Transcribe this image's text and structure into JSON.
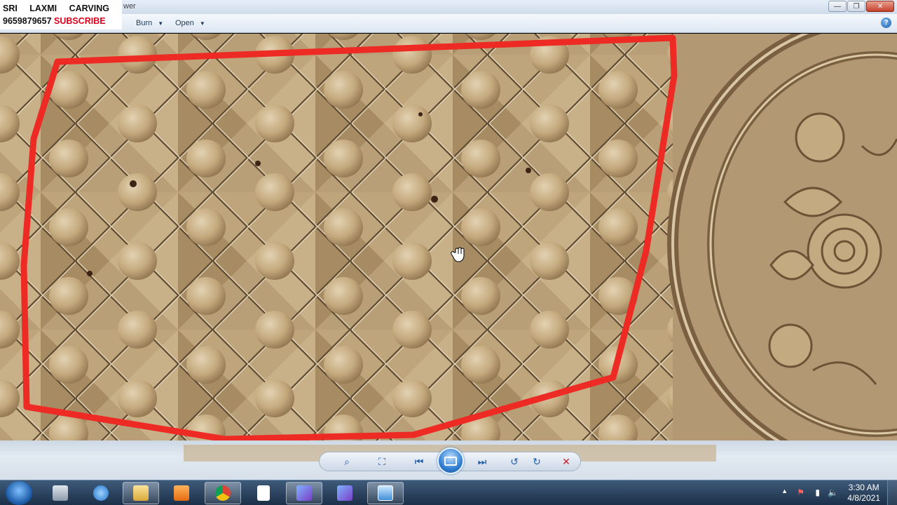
{
  "window": {
    "title_fragment": "wer",
    "controls": {
      "minimize": "—",
      "maximize": "❐",
      "close": "✕"
    }
  },
  "watermark": {
    "line1": [
      "SRI",
      "LAXMI",
      "CARVING"
    ],
    "phone": "9659879657",
    "subscribe": "SUBSCRIBE"
  },
  "menu": {
    "burn": "Burn",
    "open": "Open",
    "help": "?"
  },
  "controls": {
    "zoom": "⌕",
    "fit": "⛶",
    "previous": "⏮",
    "next": "⏭",
    "rotate_ccw": "↺",
    "rotate_cw": "↻",
    "delete": "✕"
  },
  "taskbar": {
    "clock_time": "3:30 AM",
    "clock_date": "4/8/2021",
    "tray_expand": "▲",
    "tray_flag": "⚑",
    "tray_network": "▮",
    "tray_volume": "🔈"
  },
  "colors": {
    "annotation_red": "#ee2a24",
    "subscribe_red": "#e0001b",
    "wood": "#b59a72"
  }
}
